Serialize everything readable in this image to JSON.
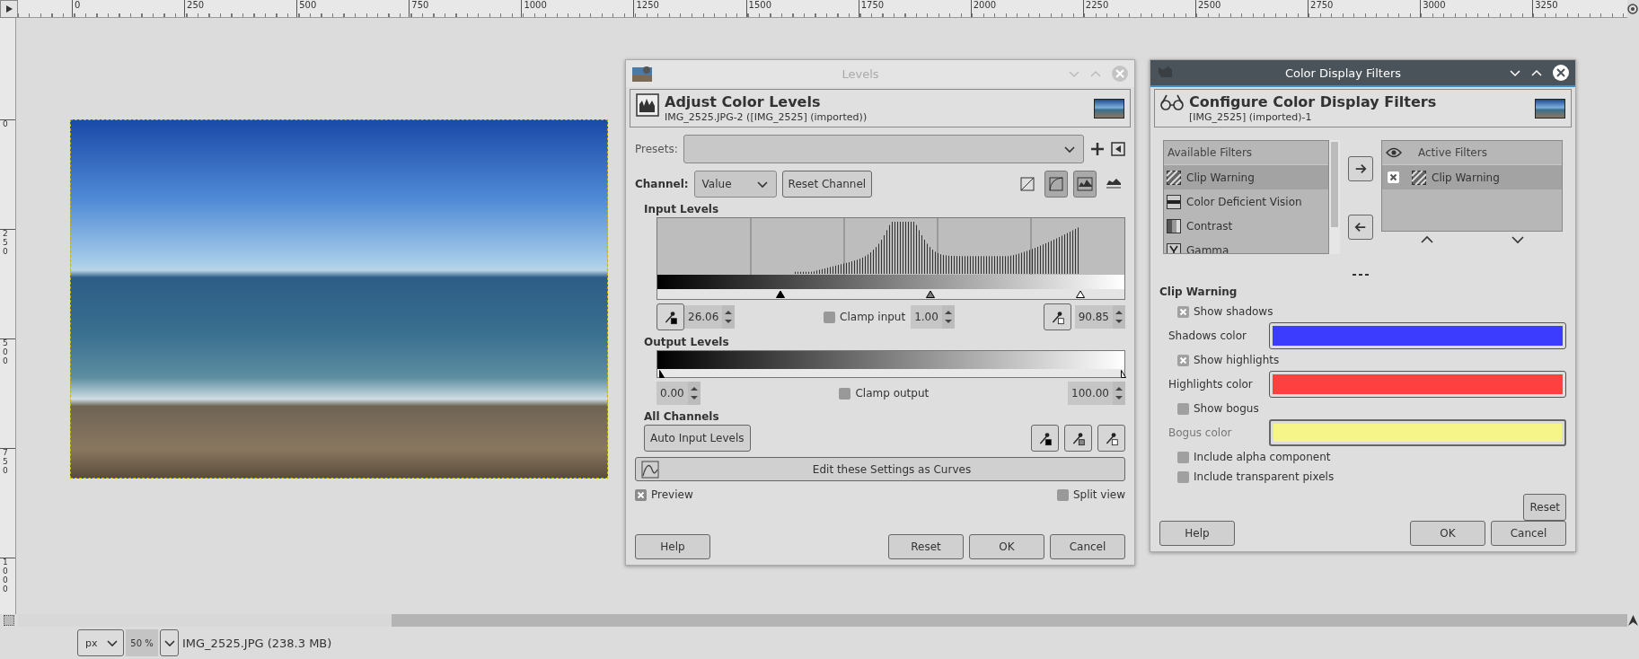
{
  "rulers": {
    "top_labels": [
      "0",
      "250",
      "500",
      "750",
      "1000",
      "1250",
      "1500",
      "1750",
      "2000",
      "2250",
      "2500",
      "2750",
      "3000",
      "3250"
    ],
    "left_labels": [
      "0",
      "250",
      "500",
      "750",
      "1000"
    ]
  },
  "levels_dialog": {
    "title": "Levels",
    "header": {
      "title": "Adjust Color Levels",
      "subtitle": "IMG_2525.JPG-2 ([IMG_2525] (imported))"
    },
    "presets": {
      "label": "Presets:"
    },
    "channel": {
      "label": "Channel:",
      "value": "Value",
      "reset": "Reset Channel"
    },
    "view_toggles": [
      {
        "kind": "linear",
        "selected": false
      },
      {
        "kind": "logarithmic",
        "selected": true
      },
      {
        "kind": "histogram",
        "selected": true
      },
      {
        "kind": "histogram-split",
        "selected": false
      }
    ],
    "input_levels": {
      "label": "Input Levels",
      "low": "26.06",
      "gamma": "1.00",
      "high": "90.85",
      "clamp": {
        "label": "Clamp input",
        "checked": false
      },
      "handles": [
        {
          "kind": "black",
          "level": 0.263
        },
        {
          "kind": "gray",
          "level": 0.585
        },
        {
          "kind": "white",
          "level": 0.906
        }
      ]
    },
    "output_levels": {
      "label": "Output Levels",
      "low": "0.00",
      "high": "100.00",
      "clamp": {
        "label": "Clamp output",
        "checked": false
      },
      "handles": [
        {
          "kind": "black",
          "level": 0
        },
        {
          "kind": "white",
          "level": 1
        }
      ]
    },
    "all_channels": {
      "label": "All Channels",
      "auto": "Auto Input Levels",
      "pickers": [
        {
          "kind": "black"
        },
        {
          "kind": "gray"
        },
        {
          "kind": "white"
        }
      ]
    },
    "curves_button": "Edit these Settings as Curves",
    "preview": {
      "label": "Preview",
      "checked": true
    },
    "split_view": {
      "label": "Split view",
      "checked": false
    },
    "buttons": [
      {
        "label": "Help"
      },
      {
        "label": "Reset"
      },
      {
        "label": "OK"
      },
      {
        "label": "Cancel"
      }
    ]
  },
  "filters_dialog": {
    "title": "Color Display Filters",
    "header": {
      "title": "Configure Color Display Filters",
      "subtitle": "[IMG_2525] (imported)-1"
    },
    "available": {
      "heading": "Available Filters",
      "items": [
        {
          "label": "Clip Warning",
          "kind": "clip",
          "selected": true
        },
        {
          "label": "Color Deficient Vision",
          "kind": "vision",
          "selected": false
        },
        {
          "label": "Contrast",
          "kind": "contrast",
          "selected": false
        },
        {
          "label": "Gamma",
          "kind": "gamma",
          "selected": false
        }
      ]
    },
    "active": {
      "heading": "Active Filters",
      "items": [
        {
          "label": "Clip Warning",
          "kind": "clip",
          "enabled": true,
          "selected": true
        }
      ]
    },
    "section": "Clip Warning",
    "options": [
      {
        "kind": "checkbox",
        "label": "Show shadows",
        "checked": true
      },
      {
        "kind": "color",
        "label": "Shadows color",
        "color": "#3c3cff",
        "disabled": false
      },
      {
        "kind": "checkbox",
        "label": "Show highlights",
        "checked": true
      },
      {
        "kind": "color",
        "label": "Highlights color",
        "color": "#ff4040",
        "disabled": false
      },
      {
        "kind": "checkbox",
        "label": "Show bogus",
        "checked": false
      },
      {
        "kind": "color",
        "label": "Bogus color",
        "color": "#f5f58a",
        "disabled": true
      },
      {
        "kind": "checkbox",
        "label": "Include alpha component",
        "checked": false
      },
      {
        "kind": "checkbox",
        "label": "Include transparent pixels",
        "checked": false
      }
    ],
    "reset": "Reset",
    "buttons": [
      {
        "label": "Help"
      },
      {
        "label": "OK"
      },
      {
        "label": "Cancel"
      }
    ]
  },
  "status_bar": {
    "unit": "px",
    "zoom": "50 %",
    "info": "IMG_2525.JPG (238.3 MB)"
  }
}
